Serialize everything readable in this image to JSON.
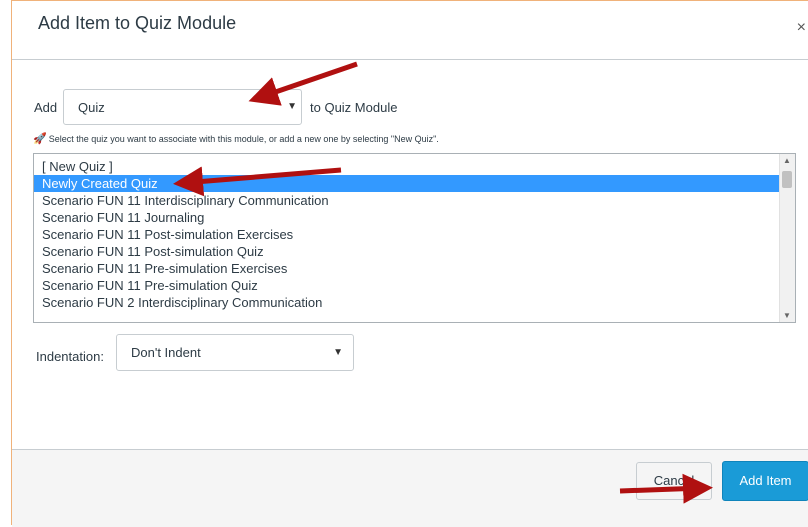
{
  "dialog": {
    "title": "Add Item to Quiz Module",
    "close_label": "×"
  },
  "add_row": {
    "add_label": "Add",
    "item_type_value": "Quiz",
    "to_module_label": "to Quiz Module"
  },
  "hint": {
    "icon": "rocket-icon",
    "text": "Select the quiz you want to associate with this module, or add a new one by selecting \"New Quiz\"."
  },
  "quiz_list": {
    "items": [
      "[ New Quiz ]",
      "Newly Created Quiz",
      "Scenario FUN 11 Interdisciplinary Communication",
      "Scenario FUN 11 Journaling",
      "Scenario FUN 11 Post-simulation Exercises",
      "Scenario FUN 11 Post-simulation Quiz",
      "Scenario FUN 11 Pre-simulation Exercises",
      "Scenario FUN 11 Pre-simulation Quiz",
      "Scenario FUN 2 Interdisciplinary Communication"
    ],
    "selected_index": 1
  },
  "indentation": {
    "label": "Indentation:",
    "value": "Don't Indent"
  },
  "footer": {
    "cancel_label": "Cancel",
    "add_item_label": "Add Item"
  },
  "colors": {
    "selection": "#3399ff",
    "primary_button": "#1a9bd7",
    "annotation_arrow": "#b01010"
  }
}
